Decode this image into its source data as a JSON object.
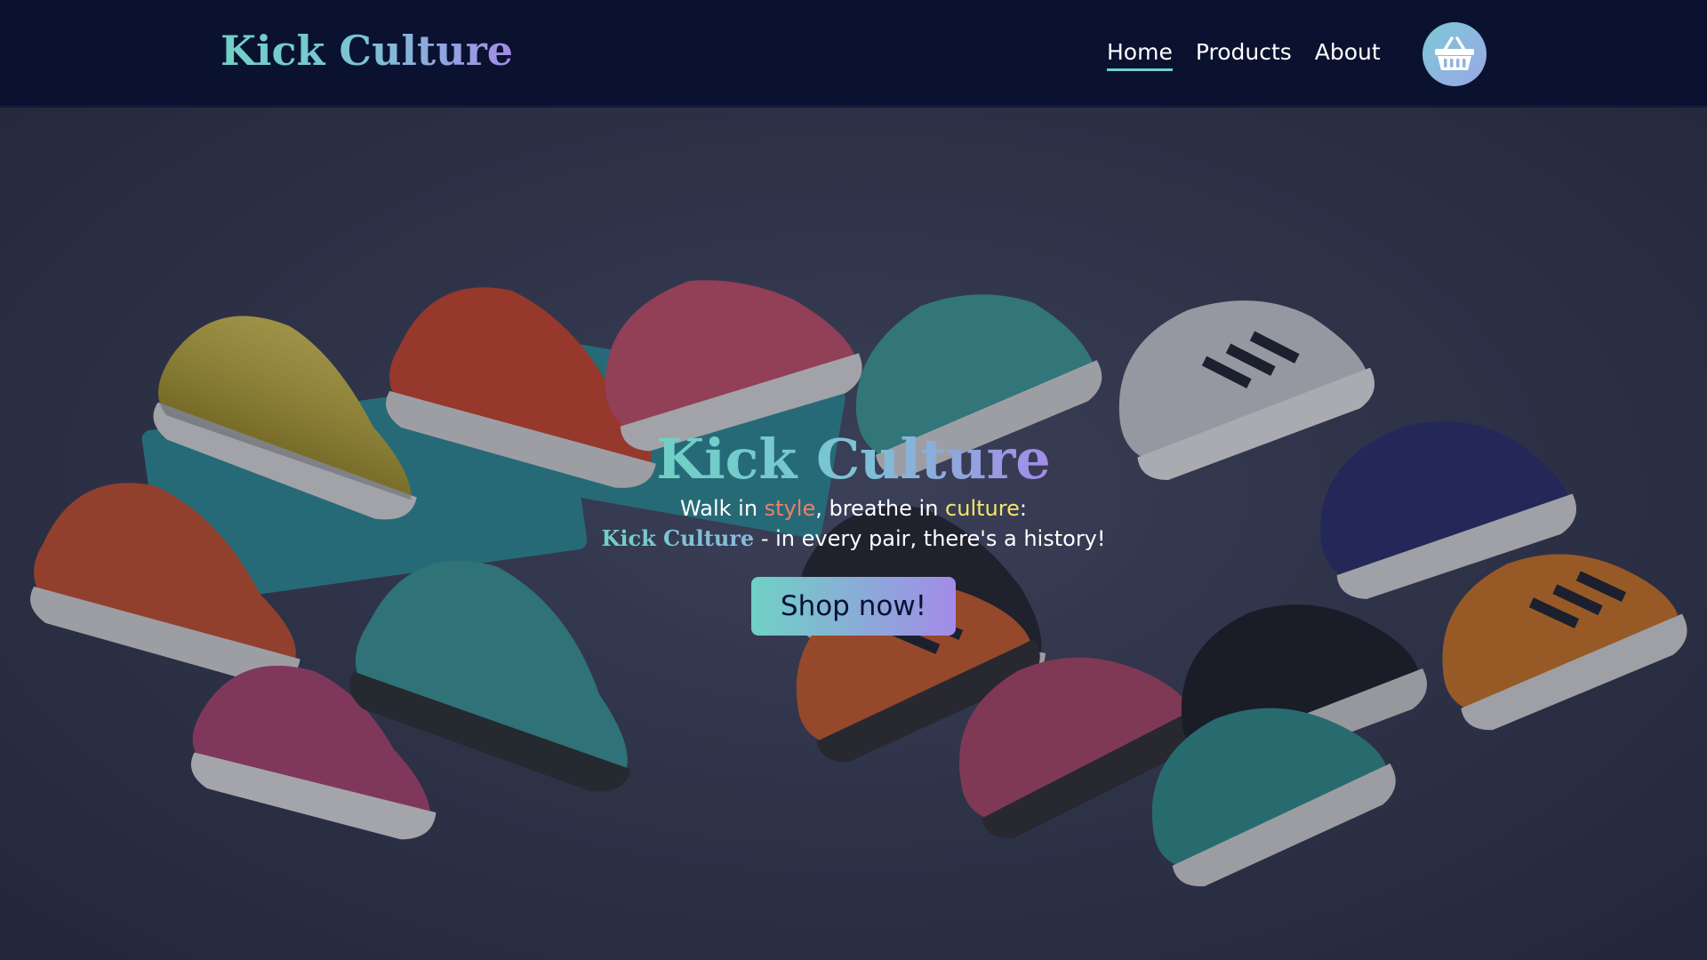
{
  "header": {
    "logo": "Kick Culture",
    "nav": [
      {
        "label": "Home",
        "active": true
      },
      {
        "label": "Products",
        "active": false
      },
      {
        "label": "About",
        "active": false
      }
    ],
    "cart_icon": "basket-icon"
  },
  "hero": {
    "title": "Kick Culture",
    "tagline_line1": {
      "part1": "Walk in ",
      "style_word": "style",
      "part2": ", breathe in ",
      "culture_word": "culture",
      "part3": ":"
    },
    "tagline_line2": {
      "brand": "Kick Culture",
      "text": " - in every pair, there's a history!"
    },
    "cta_label": "Shop now!"
  },
  "colors": {
    "accent_teal": "#6fd1c5",
    "accent_purple": "#a38be8",
    "style_word": "#f07f6a",
    "culture_word": "#f5e66a",
    "header_bg": "#0b1230"
  }
}
